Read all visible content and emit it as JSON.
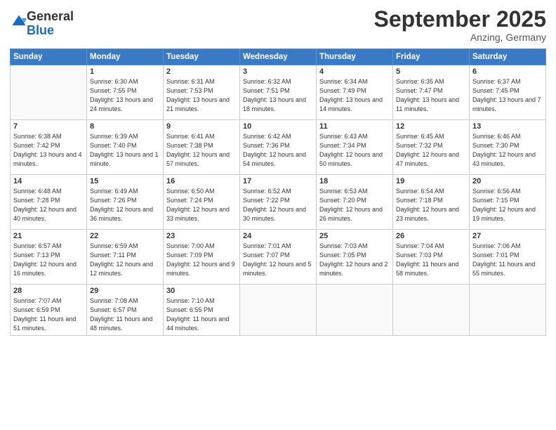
{
  "header": {
    "logo_general": "General",
    "logo_blue": "Blue",
    "month_title": "September 2025",
    "location": "Anzing, Germany"
  },
  "weekdays": [
    "Sunday",
    "Monday",
    "Tuesday",
    "Wednesday",
    "Thursday",
    "Friday",
    "Saturday"
  ],
  "weeks": [
    [
      {
        "day": "",
        "sunrise": "",
        "sunset": "",
        "daylight": ""
      },
      {
        "day": "1",
        "sunrise": "Sunrise: 6:30 AM",
        "sunset": "Sunset: 7:55 PM",
        "daylight": "Daylight: 13 hours and 24 minutes."
      },
      {
        "day": "2",
        "sunrise": "Sunrise: 6:31 AM",
        "sunset": "Sunset: 7:53 PM",
        "daylight": "Daylight: 13 hours and 21 minutes."
      },
      {
        "day": "3",
        "sunrise": "Sunrise: 6:32 AM",
        "sunset": "Sunset: 7:51 PM",
        "daylight": "Daylight: 13 hours and 18 minutes."
      },
      {
        "day": "4",
        "sunrise": "Sunrise: 6:34 AM",
        "sunset": "Sunset: 7:49 PM",
        "daylight": "Daylight: 13 hours and 14 minutes."
      },
      {
        "day": "5",
        "sunrise": "Sunrise: 6:35 AM",
        "sunset": "Sunset: 7:47 PM",
        "daylight": "Daylight: 13 hours and 11 minutes."
      },
      {
        "day": "6",
        "sunrise": "Sunrise: 6:37 AM",
        "sunset": "Sunset: 7:45 PM",
        "daylight": "Daylight: 13 hours and 7 minutes."
      }
    ],
    [
      {
        "day": "7",
        "sunrise": "Sunrise: 6:38 AM",
        "sunset": "Sunset: 7:42 PM",
        "daylight": "Daylight: 13 hours and 4 minutes."
      },
      {
        "day": "8",
        "sunrise": "Sunrise: 6:39 AM",
        "sunset": "Sunset: 7:40 PM",
        "daylight": "Daylight: 13 hours and 1 minute."
      },
      {
        "day": "9",
        "sunrise": "Sunrise: 6:41 AM",
        "sunset": "Sunset: 7:38 PM",
        "daylight": "Daylight: 12 hours and 57 minutes."
      },
      {
        "day": "10",
        "sunrise": "Sunrise: 6:42 AM",
        "sunset": "Sunset: 7:36 PM",
        "daylight": "Daylight: 12 hours and 54 minutes."
      },
      {
        "day": "11",
        "sunrise": "Sunrise: 6:43 AM",
        "sunset": "Sunset: 7:34 PM",
        "daylight": "Daylight: 12 hours and 50 minutes."
      },
      {
        "day": "12",
        "sunrise": "Sunrise: 6:45 AM",
        "sunset": "Sunset: 7:32 PM",
        "daylight": "Daylight: 12 hours and 47 minutes."
      },
      {
        "day": "13",
        "sunrise": "Sunrise: 6:46 AM",
        "sunset": "Sunset: 7:30 PM",
        "daylight": "Daylight: 12 hours and 43 minutes."
      }
    ],
    [
      {
        "day": "14",
        "sunrise": "Sunrise: 6:48 AM",
        "sunset": "Sunset: 7:28 PM",
        "daylight": "Daylight: 12 hours and 40 minutes."
      },
      {
        "day": "15",
        "sunrise": "Sunrise: 6:49 AM",
        "sunset": "Sunset: 7:26 PM",
        "daylight": "Daylight: 12 hours and 36 minutes."
      },
      {
        "day": "16",
        "sunrise": "Sunrise: 6:50 AM",
        "sunset": "Sunset: 7:24 PM",
        "daylight": "Daylight: 12 hours and 33 minutes."
      },
      {
        "day": "17",
        "sunrise": "Sunrise: 6:52 AM",
        "sunset": "Sunset: 7:22 PM",
        "daylight": "Daylight: 12 hours and 30 minutes."
      },
      {
        "day": "18",
        "sunrise": "Sunrise: 6:53 AM",
        "sunset": "Sunset: 7:20 PM",
        "daylight": "Daylight: 12 hours and 26 minutes."
      },
      {
        "day": "19",
        "sunrise": "Sunrise: 6:54 AM",
        "sunset": "Sunset: 7:18 PM",
        "daylight": "Daylight: 12 hours and 23 minutes."
      },
      {
        "day": "20",
        "sunrise": "Sunrise: 6:56 AM",
        "sunset": "Sunset: 7:15 PM",
        "daylight": "Daylight: 12 hours and 19 minutes."
      }
    ],
    [
      {
        "day": "21",
        "sunrise": "Sunrise: 6:57 AM",
        "sunset": "Sunset: 7:13 PM",
        "daylight": "Daylight: 12 hours and 16 minutes."
      },
      {
        "day": "22",
        "sunrise": "Sunrise: 6:59 AM",
        "sunset": "Sunset: 7:11 PM",
        "daylight": "Daylight: 12 hours and 12 minutes."
      },
      {
        "day": "23",
        "sunrise": "Sunrise: 7:00 AM",
        "sunset": "Sunset: 7:09 PM",
        "daylight": "Daylight: 12 hours and 9 minutes."
      },
      {
        "day": "24",
        "sunrise": "Sunrise: 7:01 AM",
        "sunset": "Sunset: 7:07 PM",
        "daylight": "Daylight: 12 hours and 5 minutes."
      },
      {
        "day": "25",
        "sunrise": "Sunrise: 7:03 AM",
        "sunset": "Sunset: 7:05 PM",
        "daylight": "Daylight: 12 hours and 2 minutes."
      },
      {
        "day": "26",
        "sunrise": "Sunrise: 7:04 AM",
        "sunset": "Sunset: 7:03 PM",
        "daylight": "Daylight: 11 hours and 58 minutes."
      },
      {
        "day": "27",
        "sunrise": "Sunrise: 7:06 AM",
        "sunset": "Sunset: 7:01 PM",
        "daylight": "Daylight: 11 hours and 55 minutes."
      }
    ],
    [
      {
        "day": "28",
        "sunrise": "Sunrise: 7:07 AM",
        "sunset": "Sunset: 6:59 PM",
        "daylight": "Daylight: 11 hours and 51 minutes."
      },
      {
        "day": "29",
        "sunrise": "Sunrise: 7:08 AM",
        "sunset": "Sunset: 6:57 PM",
        "daylight": "Daylight: 11 hours and 48 minutes."
      },
      {
        "day": "30",
        "sunrise": "Sunrise: 7:10 AM",
        "sunset": "Sunset: 6:55 PM",
        "daylight": "Daylight: 11 hours and 44 minutes."
      },
      {
        "day": "",
        "sunrise": "",
        "sunset": "",
        "daylight": ""
      },
      {
        "day": "",
        "sunrise": "",
        "sunset": "",
        "daylight": ""
      },
      {
        "day": "",
        "sunrise": "",
        "sunset": "",
        "daylight": ""
      },
      {
        "day": "",
        "sunrise": "",
        "sunset": "",
        "daylight": ""
      }
    ]
  ]
}
